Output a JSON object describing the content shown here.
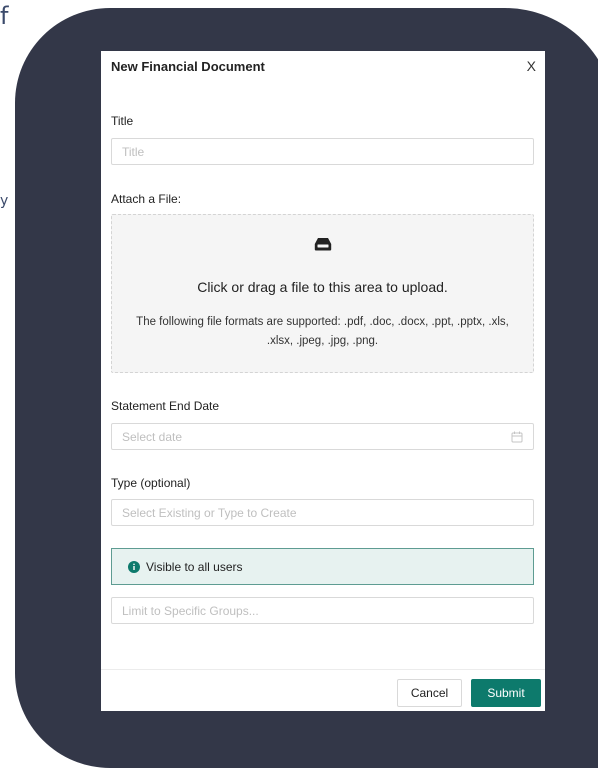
{
  "background": {
    "letter_top": "f",
    "letter_side": "y"
  },
  "modal": {
    "title": "New Financial Document",
    "close_label": "X"
  },
  "form": {
    "title_label": "Title",
    "title_placeholder": "Title",
    "attach_label": "Attach a File:",
    "upload_main": "Click or drag a file to this area to upload.",
    "upload_formats": "The following file formats are supported: .pdf, .doc, .docx, .ppt, .pptx, .xls, .xlsx, .jpeg, .jpg, .png.",
    "date_label": "Statement End Date",
    "date_placeholder": "Select date",
    "type_label": "Type (optional)",
    "type_placeholder": "Select Existing or Type to Create",
    "visibility_notice": "Visible to all users",
    "groups_placeholder": "Limit to Specific Groups..."
  },
  "footer": {
    "cancel_label": "Cancel",
    "submit_label": "Submit"
  },
  "icons": {
    "upload": "inbox-icon",
    "date": "calendar-icon",
    "notice": "info-circle-icon"
  },
  "colors": {
    "backdrop": "#333748",
    "accent": "#0d7a6c",
    "notice_bg": "#e7f2f0",
    "notice_border": "#5e9c92"
  }
}
